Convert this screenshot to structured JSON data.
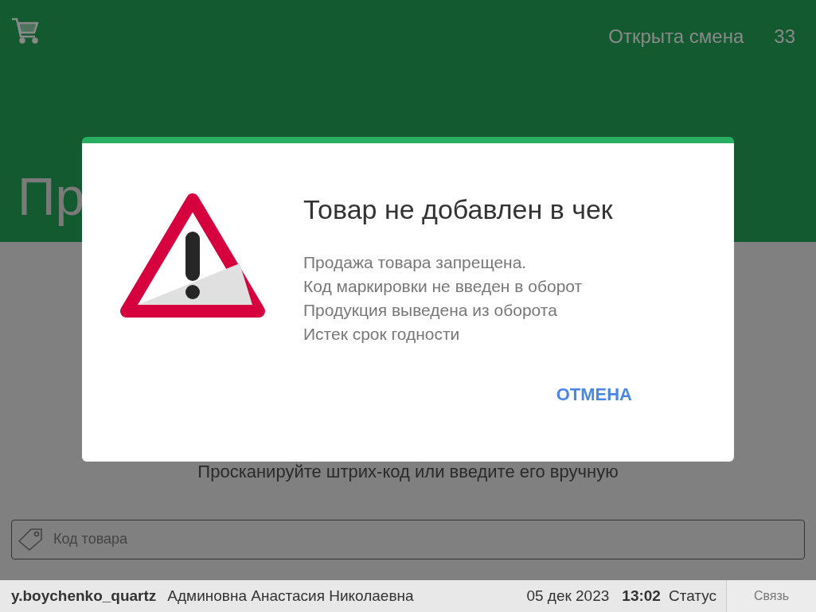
{
  "header": {
    "shift_status": "Открыта смена",
    "shift_number": "33",
    "title": "Пр"
  },
  "scan_hint": "Просканируйте штрих-код или введите его вручную",
  "barcode_field": {
    "placeholder": "Код товара"
  },
  "status_bar": {
    "user": "y.boychenko_quartz",
    "full_name": "Админовна Анастасия Николаевна",
    "date": "05 дек 2023",
    "time": "13:02",
    "status": "Статус",
    "link_button": "Связь"
  },
  "dialog": {
    "title": "Товар не добавлен в чек",
    "messages": [
      "Продажа товара запрещена.",
      "Код маркировки не введен в оборот",
      "Продукция выведена из оборота",
      "Истек срок годности"
    ],
    "buttons": [
      "ОТМЕНА"
    ]
  }
}
